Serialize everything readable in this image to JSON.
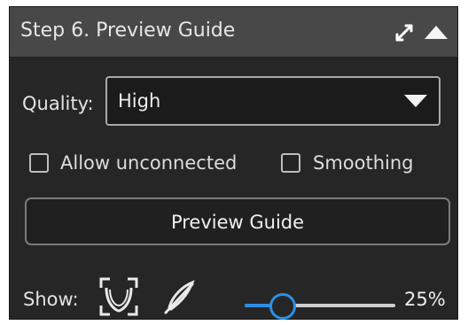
{
  "panel": {
    "title": "Step 6. Preview Guide",
    "icons": {
      "expand": "expand-icon",
      "collapse": "collapse-up-icon"
    }
  },
  "quality": {
    "label": "Quality:",
    "selected": "High"
  },
  "options": {
    "allow_unconnected": {
      "label": "Allow unconnected",
      "checked": false
    },
    "smoothing": {
      "label": "Smoothing",
      "checked": false
    }
  },
  "actions": {
    "preview_label": "Preview Guide"
  },
  "show": {
    "label": "Show:",
    "icons": [
      "teeth-view-icon",
      "visibility-feather-icon"
    ],
    "slider_percent": 25,
    "slider_text": "25%"
  },
  "colors": {
    "panel_bg": "#262626",
    "header_bg": "#484848",
    "accent": "#2b8ee0"
  }
}
